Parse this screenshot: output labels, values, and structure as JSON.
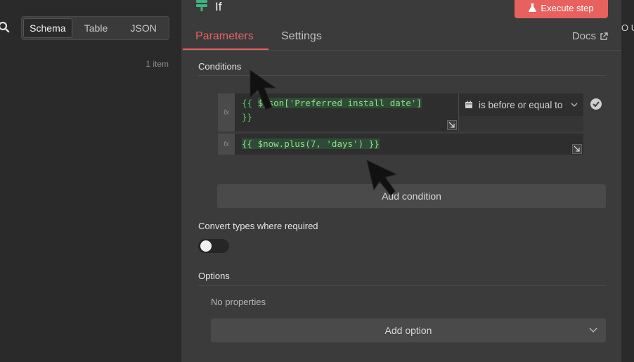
{
  "left_pane": {
    "tabs": [
      {
        "label": "Schema",
        "active": true
      },
      {
        "label": "Table",
        "active": false
      },
      {
        "label": "JSON",
        "active": false
      }
    ],
    "item_count": "1 item"
  },
  "right_strip": {
    "text": "O U"
  },
  "node": {
    "title": "If",
    "execute_label": "Execute step",
    "tabs": [
      {
        "label": "Parameters",
        "active": true
      },
      {
        "label": "Settings",
        "active": false
      }
    ],
    "docs_label": "Docs"
  },
  "conditions": {
    "label": "Conditions",
    "fx_label": "fx",
    "left_value_prefix": "{{ ",
    "left_value_highlight": "$json['Preferred install date']",
    "left_value_line2": "}}",
    "operator": "is before or equal to",
    "right_value": "{{ $now.plus(7, 'days') }}",
    "add_label": "Add condition"
  },
  "convert_types": {
    "label": "Convert types where required",
    "enabled": false
  },
  "options": {
    "label": "Options",
    "empty_text": "No properties",
    "add_label": "Add option"
  },
  "colors": {
    "accent": "#e8615e",
    "expression": "#61c45f",
    "panel": "#3b3b3c",
    "background": "#2a2a2b"
  }
}
